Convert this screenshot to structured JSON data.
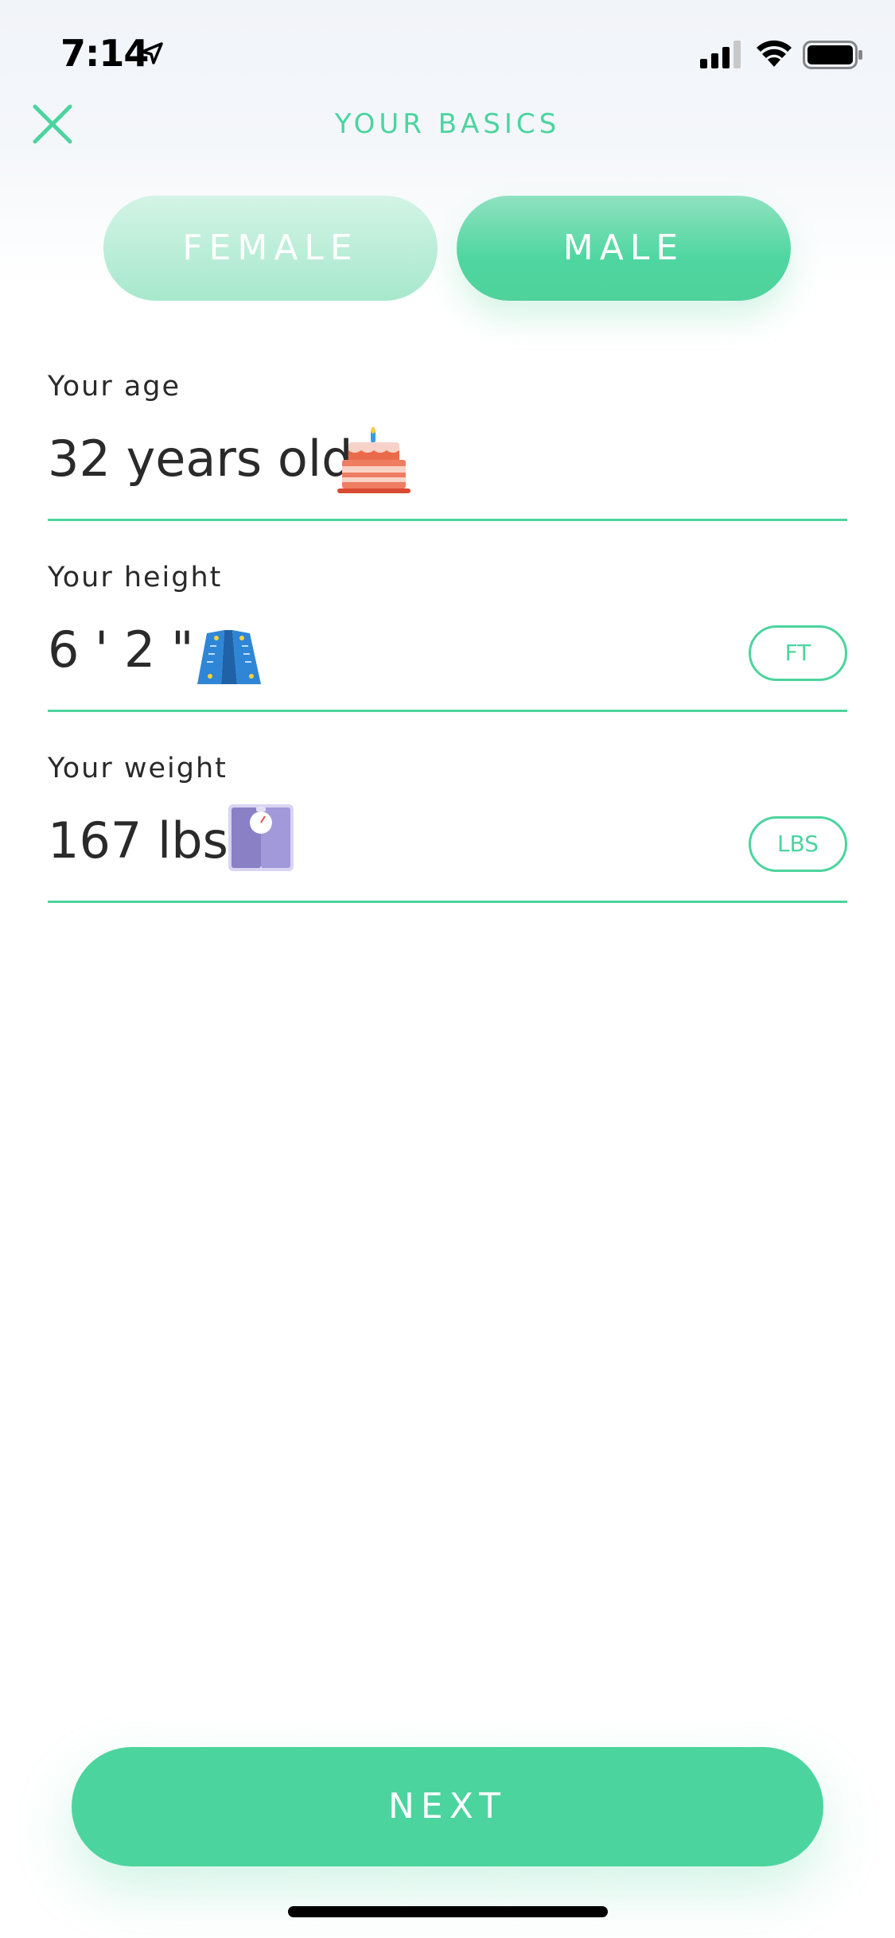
{
  "status_bar": {
    "time": "7:14"
  },
  "header": {
    "title": "YOUR BASICS"
  },
  "gender": {
    "female_label": "FEMALE",
    "male_label": "MALE",
    "selected": "MALE"
  },
  "fields": {
    "age": {
      "label": "Your age",
      "value": "32 years old",
      "icon": "birthday-cake-icon"
    },
    "height": {
      "label": "Your height",
      "value": "6 ' 2 \"",
      "unit": "FT",
      "icon": "measuring-tape-icon"
    },
    "weight": {
      "label": "Your weight",
      "value": "167 lbs",
      "unit": "LBS",
      "icon": "weight-scale-icon"
    }
  },
  "footer": {
    "next_label": "NEXT"
  },
  "colors": {
    "accent": "#4cd49e",
    "accent_light": "#a7e8cc",
    "text": "#2a2a2a"
  }
}
